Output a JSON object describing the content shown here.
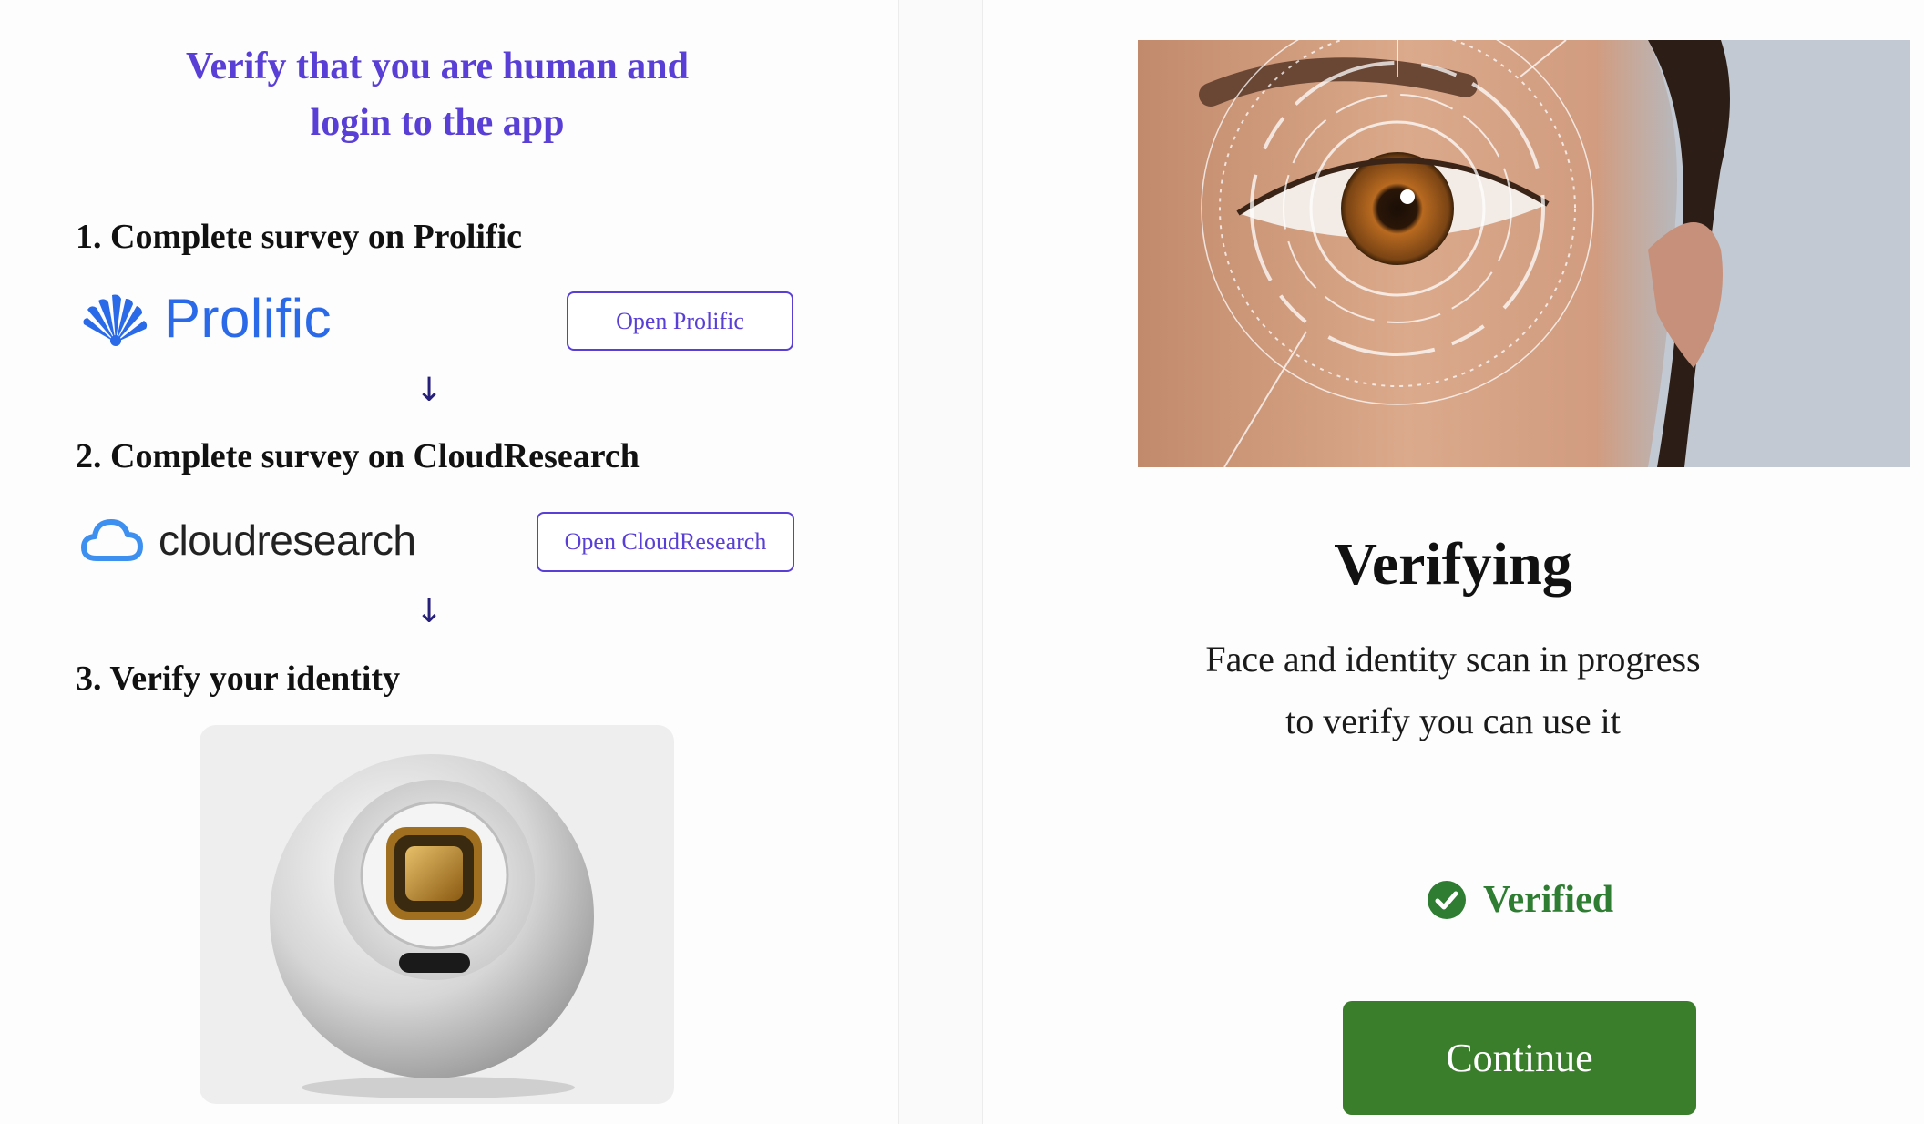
{
  "header": {
    "line1": "Verify that you are human and",
    "line2": "login to the app"
  },
  "steps": [
    {
      "title": "1. Complete survey on Prolific",
      "brand": "Prolific",
      "button_label": "Open Prolific",
      "icon": "prolific-logo-icon"
    },
    {
      "title": "2. Complete survey on CloudResearch",
      "brand": "cloudresearch",
      "button_label": "Open CloudResearch",
      "icon": "cloud-icon"
    },
    {
      "title": "3. Verify your identity",
      "image": "iris-scanner-orb"
    }
  ],
  "arrow_glyph": "↓",
  "verification": {
    "title": "Verifying",
    "subtitle_line1": "Face and identity scan in progress",
    "subtitle_line2": "to verify you can use it",
    "status_label": "Verified",
    "status_icon": "check-circle-icon",
    "continue_label": "Continue"
  },
  "colors": {
    "accent": "#5a3fd6",
    "brand_blue": "#2a6ae8",
    "success": "#2f7d32",
    "continue_bg": "#3a7d2a",
    "arrow": "#27207a"
  }
}
